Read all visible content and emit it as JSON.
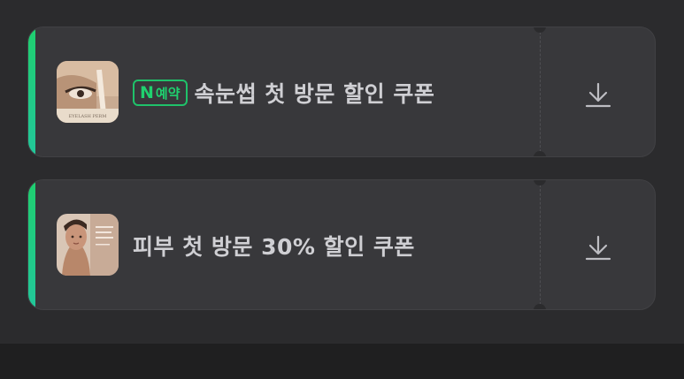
{
  "coupons": [
    {
      "badge": {
        "n": "N",
        "text": "예약"
      },
      "title": "속눈썹 첫 방문 할인 쿠폰",
      "thumbnail_caption": "EYELASH PERM",
      "download_icon": "download-icon"
    },
    {
      "title": "피부 첫 방문 30% 할인 쿠폰",
      "download_icon": "download-icon"
    }
  ],
  "colors": {
    "accent": "#1fcf6f",
    "card_bg": "#38383b",
    "page_bg": "#2b2b2d",
    "title_text": "#cfcfd3"
  }
}
